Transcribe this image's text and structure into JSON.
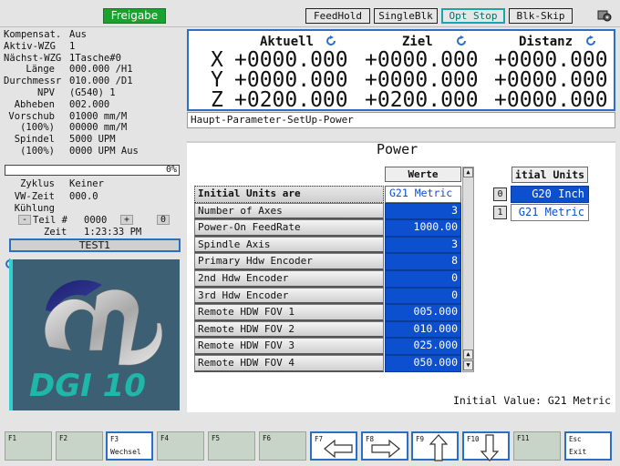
{
  "topbar": {
    "status": "Freigabe",
    "buttons": [
      "FeedHold",
      "SingleBlk",
      "Opt Stop",
      "Blk-Skip"
    ]
  },
  "info": [
    {
      "k": "Kompensat.",
      "v": "Aus"
    },
    {
      "k": "Aktiv-WZG",
      "v": "1"
    },
    {
      "k": "Nächst-WZG",
      "v": "1Tasche#0"
    },
    {
      "k": "Länge",
      "v": "000.000 /H1"
    },
    {
      "k": "Durchmessr",
      "v": "010.000 /D1"
    },
    {
      "k": "NPV",
      "v": "(G540) 1"
    },
    {
      "k": "Abheben",
      "v": "002.000"
    },
    {
      "k": "Vorschub",
      "v": "01000 mm/M"
    },
    {
      "k": "(100%)",
      "v": "00000 mm/M"
    },
    {
      "k": "Spindel",
      "v": "5000 UPM"
    },
    {
      "k": "(100%)",
      "v": "0000 UPM Aus"
    }
  ],
  "progress": "0%",
  "info2": [
    {
      "k": "Zyklus",
      "v": "Keiner"
    },
    {
      "k": "VW-Zeit",
      "v": "000.0"
    },
    {
      "k": "Kühlung",
      "v": ""
    }
  ],
  "teil": {
    "label": "Teil #",
    "minus": "-",
    "value": "0000",
    "plus": "+",
    "count": "0"
  },
  "zeit": {
    "label": "Zeit",
    "value": "1:23:33 PM"
  },
  "program": "TEST1",
  "logo": {
    "text": "DGI 10"
  },
  "axes": {
    "headers": [
      "Aktuell",
      "Ziel",
      "Distanz"
    ],
    "rows": [
      {
        "axis": "X",
        "aktuell": "+0000.000",
        "ziel": "+0000.000",
        "distanz": "+0000.000"
      },
      {
        "axis": "Y",
        "aktuell": "+0000.000",
        "ziel": "+0000.000",
        "distanz": "+0000.000"
      },
      {
        "axis": "Z",
        "aktuell": "+0200.000",
        "ziel": "+0200.000",
        "distanz": "+0000.000"
      }
    ]
  },
  "breadcrumb": "Haupt-Parameter-SetUp-Power",
  "panel": {
    "title": "Power",
    "column_header": "Werte",
    "rows": [
      {
        "name": "Initial Units are",
        "value": "G21 Metric"
      },
      {
        "name": "Number of Axes",
        "value": "3"
      },
      {
        "name": "Power-On FeedRate",
        "value": "1000.00"
      },
      {
        "name": "Spindle Axis",
        "value": "3"
      },
      {
        "name": "Primary Hdw Encoder",
        "value": "8"
      },
      {
        "name": "2nd Hdw Encoder",
        "value": "0"
      },
      {
        "name": "3rd Hdw Encoder",
        "value": "0"
      },
      {
        "name": "Remote HDW FOV 1",
        "value": "005.000"
      },
      {
        "name": "Remote HDW FOV 2",
        "value": "010.000"
      },
      {
        "name": "Remote HDW FOV 3",
        "value": "025.000"
      },
      {
        "name": "Remote HDW FOV 4",
        "value": "050.000"
      }
    ],
    "options_header": "itial Units a",
    "options": [
      {
        "idx": "0",
        "label": "G20 Inch"
      },
      {
        "idx": "1",
        "label": "G21 Metric"
      }
    ],
    "initial_value": "Initial Value: G21 Metric"
  },
  "fkeys": [
    {
      "key": "F1",
      "sub": ""
    },
    {
      "key": "F2",
      "sub": ""
    },
    {
      "key": "F3",
      "sub": "Wechsel"
    },
    {
      "key": "F4",
      "sub": ""
    },
    {
      "key": "F5",
      "sub": ""
    },
    {
      "key": "F6",
      "sub": ""
    },
    {
      "key": "F7",
      "sub": "",
      "icon": "arrow-left-icon"
    },
    {
      "key": "F8",
      "sub": "",
      "icon": "arrow-right-icon"
    },
    {
      "key": "F9",
      "sub": "",
      "icon": "arrow-up-icon"
    },
    {
      "key": "F10",
      "sub": "",
      "icon": "arrow-down-icon"
    },
    {
      "key": "F11",
      "sub": ""
    },
    {
      "key": "Esc",
      "sub": "Exit"
    }
  ],
  "colors": {
    "accent": "#2a6fc2",
    "value_bg": "#0c4fcf",
    "status_green": "#1aa12f"
  }
}
